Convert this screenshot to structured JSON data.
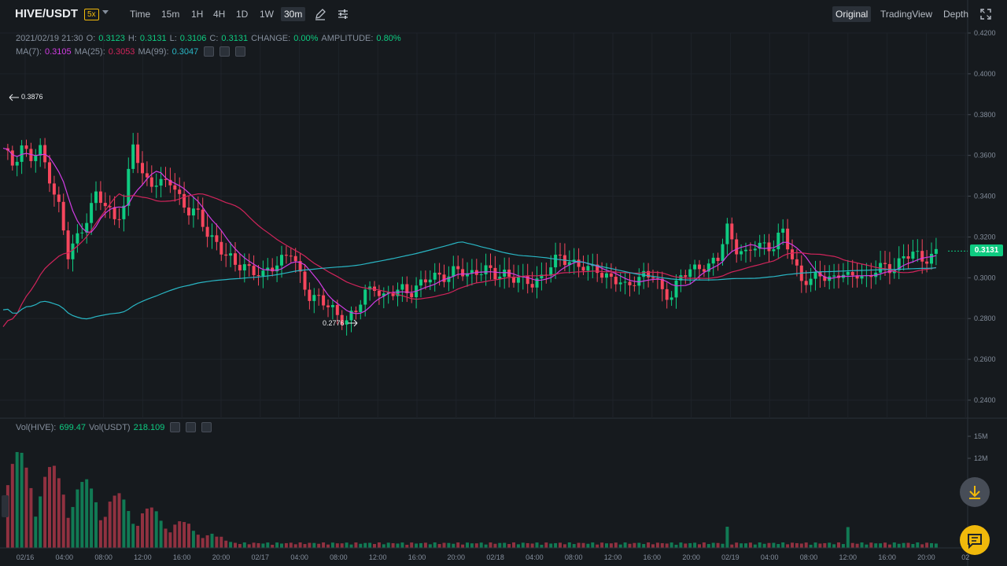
{
  "header": {
    "pair": "HIVE/USDT",
    "leverage": "5x",
    "intervals": [
      "Time",
      "15m",
      "1H",
      "4H",
      "1D",
      "1W",
      "30m"
    ],
    "active_interval": "30m",
    "views": [
      "Original",
      "TradingView",
      "Depth"
    ],
    "active_view": "Original"
  },
  "ohlc": {
    "datetime": "2021/02/19 21:30",
    "o_label": "O:",
    "o": "0.3123",
    "h_label": "H:",
    "h": "0.3131",
    "l_label": "L:",
    "l": "0.3106",
    "c_label": "C:",
    "c": "0.3131",
    "change_label": "CHANGE:",
    "change": "0.00%",
    "amp_label": "AMPLITUDE:",
    "amplitude": "0.80%"
  },
  "ma": {
    "ma7_label": "MA(7):",
    "ma7": "0.3105",
    "ma25_label": "MA(25):",
    "ma25": "0.3053",
    "ma99_label": "MA(99):",
    "ma99": "0.3047"
  },
  "vol": {
    "hive_label": "Vol(HIVE):",
    "hive": "699.47",
    "usdt_label": "Vol(USDT)",
    "usdt": "218.109"
  },
  "current_price": "0.3131",
  "high_marker": "0.3876",
  "low_marker": "0.2776",
  "colors": {
    "up": "#0ecb81",
    "down": "#f6465d",
    "ma7": "#d13ce3",
    "ma25": "#d1245b",
    "ma99": "#29b6c4",
    "bg": "#161a1e"
  },
  "chart_data": {
    "type": "candlestick",
    "price_ticks": [
      "0.4200",
      "0.4000",
      "0.3800",
      "0.3600",
      "0.3400",
      "0.3200",
      "0.3000",
      "0.2800",
      "0.2600",
      "0.2400"
    ],
    "price_range": [
      0.24,
      0.42
    ],
    "volume_ticks": [
      "15M",
      "12M"
    ],
    "time_ticks": [
      "02/16",
      "04:00",
      "08:00",
      "12:00",
      "16:00",
      "20:00",
      "02/17",
      "04:00",
      "08:00",
      "12:00",
      "16:00",
      "20:00",
      "02/18",
      "04:00",
      "08:00",
      "12:00",
      "16:00",
      "20:00",
      "02/19",
      "04:00",
      "08:00",
      "12:00",
      "16:00",
      "20:00",
      "02"
    ],
    "price_path": [
      [
        0,
        0.362
      ],
      [
        2,
        0.356
      ],
      [
        4,
        0.365
      ],
      [
        6,
        0.358
      ],
      [
        8,
        0.362
      ],
      [
        10,
        0.35
      ],
      [
        12,
        0.335
      ],
      [
        14,
        0.31
      ],
      [
        16,
        0.32
      ],
      [
        18,
        0.33
      ],
      [
        20,
        0.34
      ],
      [
        22,
        0.335
      ],
      [
        24,
        0.33
      ],
      [
        26,
        0.335
      ],
      [
        28,
        0.365
      ],
      [
        30,
        0.35
      ],
      [
        32,
        0.348
      ],
      [
        34,
        0.345
      ],
      [
        36,
        0.347
      ],
      [
        38,
        0.34
      ],
      [
        40,
        0.333
      ],
      [
        42,
        0.33
      ],
      [
        44,
        0.322
      ],
      [
        46,
        0.318
      ],
      [
        48,
        0.31
      ],
      [
        50,
        0.306
      ],
      [
        52,
        0.307
      ],
      [
        54,
        0.303
      ],
      [
        56,
        0.3
      ],
      [
        58,
        0.306
      ],
      [
        60,
        0.31
      ],
      [
        62,
        0.312
      ],
      [
        64,
        0.3
      ],
      [
        66,
        0.292
      ],
      [
        68,
        0.29
      ],
      [
        70,
        0.285
      ],
      [
        72,
        0.282
      ],
      [
        74,
        0.28
      ],
      [
        76,
        0.283
      ],
      [
        78,
        0.292
      ],
      [
        80,
        0.297
      ],
      [
        82,
        0.29
      ],
      [
        84,
        0.292
      ],
      [
        86,
        0.295
      ],
      [
        88,
        0.294
      ],
      [
        90,
        0.296
      ],
      [
        92,
        0.3
      ],
      [
        94,
        0.302
      ],
      [
        96,
        0.301
      ],
      [
        98,
        0.303
      ],
      [
        100,
        0.302
      ],
      [
        102,
        0.304
      ],
      [
        104,
        0.303
      ],
      [
        106,
        0.301
      ],
      [
        108,
        0.303
      ],
      [
        110,
        0.3
      ],
      [
        112,
        0.297
      ],
      [
        114,
        0.298
      ],
      [
        116,
        0.301
      ],
      [
        118,
        0.305
      ],
      [
        120,
        0.31
      ],
      [
        122,
        0.309
      ],
      [
        124,
        0.306
      ],
      [
        126,
        0.303
      ],
      [
        128,
        0.305
      ],
      [
        130,
        0.301
      ],
      [
        132,
        0.298
      ],
      [
        134,
        0.295
      ],
      [
        136,
        0.3
      ],
      [
        138,
        0.301
      ],
      [
        140,
        0.3
      ],
      [
        142,
        0.294
      ],
      [
        144,
        0.292
      ],
      [
        146,
        0.3
      ],
      [
        148,
        0.303
      ],
      [
        150,
        0.307
      ],
      [
        152,
        0.305
      ],
      [
        154,
        0.309
      ],
      [
        156,
        0.325
      ],
      [
        158,
        0.315
      ],
      [
        160,
        0.31
      ],
      [
        162,
        0.316
      ],
      [
        164,
        0.317
      ],
      [
        166,
        0.315
      ],
      [
        168,
        0.322
      ],
      [
        170,
        0.31
      ],
      [
        172,
        0.3
      ],
      [
        174,
        0.297
      ],
      [
        176,
        0.302
      ],
      [
        178,
        0.3
      ],
      [
        180,
        0.302
      ],
      [
        182,
        0.299
      ],
      [
        184,
        0.303
      ],
      [
        186,
        0.3
      ],
      [
        188,
        0.303
      ],
      [
        190,
        0.305
      ],
      [
        192,
        0.306
      ],
      [
        194,
        0.31
      ],
      [
        196,
        0.311
      ],
      [
        198,
        0.31
      ],
      [
        200,
        0.311
      ],
      [
        202,
        0.313
      ]
    ]
  }
}
